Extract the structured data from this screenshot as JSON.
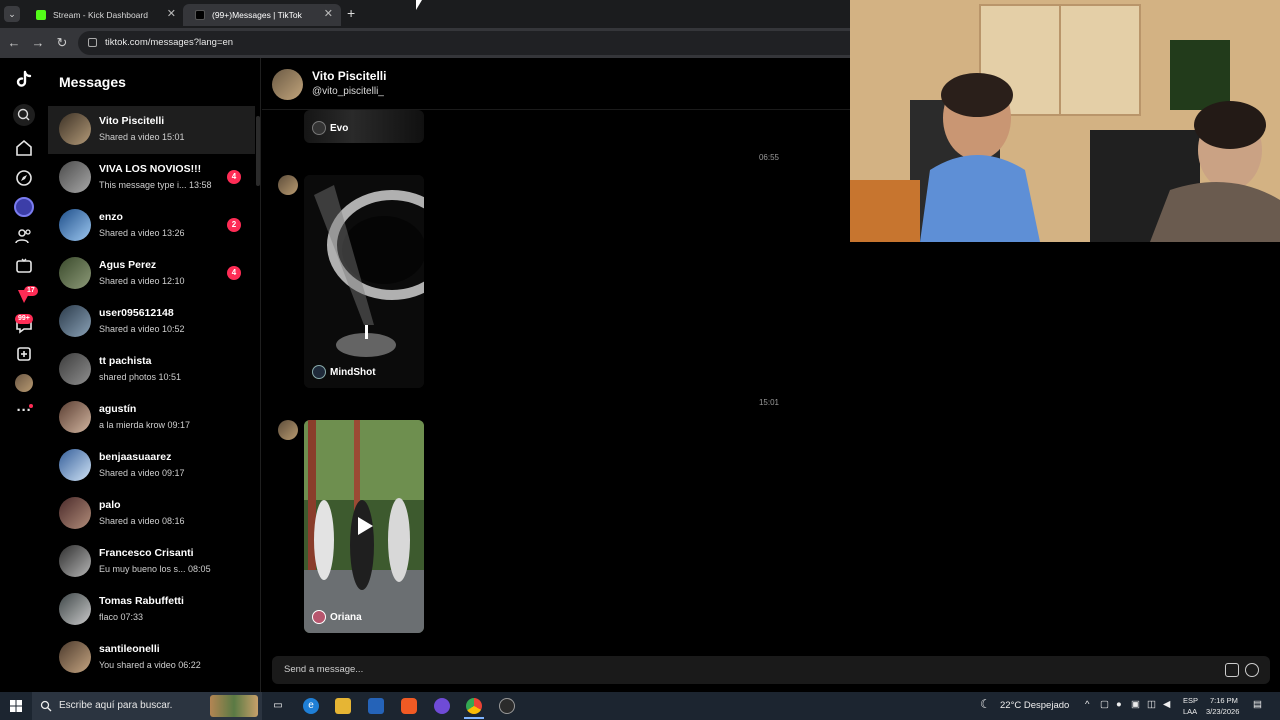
{
  "browser": {
    "tabs": [
      {
        "title": "Stream - Kick Dashboard",
        "favicon_color": "#53fc18",
        "active": false
      },
      {
        "title": "(99+)Messages | TikTok",
        "favicon_color": "#000000",
        "active": true
      }
    ],
    "url": "tiktok.com/messages?lang=en"
  },
  "rail": {
    "icons": [
      "tiktok-logo-icon",
      "search-icon",
      "home-icon",
      "explore-icon",
      "following-avatar-icon",
      "friends-icon",
      "live-icon",
      "activity-icon",
      "messages-icon",
      "upload-icon",
      "profile-icon",
      "more-icon"
    ],
    "activity_badge": "17",
    "messages_badge": "99+"
  },
  "conversations": {
    "title": "Messages",
    "items": [
      {
        "name": "Vito Piscitelli",
        "preview": "Shared a video 15:01",
        "unread": ""
      },
      {
        "name": "VIVA LOS NOVIOS!!!",
        "preview": "This message type i... 13:58",
        "unread": "4"
      },
      {
        "name": "enzo",
        "preview": "Shared a video 13:26",
        "unread": "2"
      },
      {
        "name": "Agus Perez",
        "preview": "Shared a video 12:10",
        "unread": "4"
      },
      {
        "name": "user095612148",
        "preview": "Shared a video 10:52",
        "unread": ""
      },
      {
        "name": "tt pachista",
        "preview": "shared photos 10:51",
        "unread": ""
      },
      {
        "name": "agustín",
        "preview": "a la mierda krow 09:17",
        "unread": ""
      },
      {
        "name": "benjaasuaarez",
        "preview": "Shared a video 09:17",
        "unread": ""
      },
      {
        "name": "palo",
        "preview": "Shared a video 08:16",
        "unread": ""
      },
      {
        "name": "Francesco Crisanti",
        "preview": "Eu muy bueno los s... 08:05",
        "unread": ""
      },
      {
        "name": "Tomas Rabuffetti",
        "preview": "flaco 07:33",
        "unread": ""
      },
      {
        "name": "santileonelli",
        "preview": "You shared a video 06:22",
        "unread": ""
      }
    ]
  },
  "chat": {
    "name": "Vito Piscitelli",
    "handle": "@vito_piscitelli_",
    "messages": [
      {
        "author": "Evo"
      },
      {
        "timestamp": "06:55",
        "author": "MindShot"
      },
      {
        "timestamp": "15:01",
        "author": "Oriana"
      }
    ],
    "composer_placeholder": "Send a message..."
  },
  "taskbar": {
    "search_placeholder": "Escribe aquí para buscar.",
    "weather": "22°C  Despejado",
    "lang": "ESP",
    "lang_sub": "LAA",
    "time": "7:16 PM",
    "date": "3/23/2026"
  }
}
